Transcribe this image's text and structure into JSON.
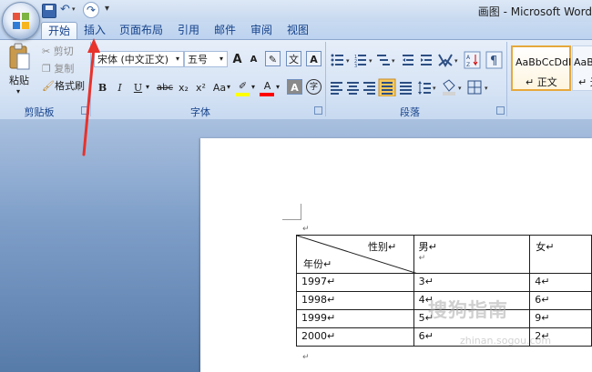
{
  "window": {
    "title": "画图 - Microsoft Word"
  },
  "quick_access": {
    "undo_glyph": "↶",
    "redo_glyph": "↷",
    "more_glyph": "▾"
  },
  "tabs": [
    "开始",
    "插入",
    "页面布局",
    "引用",
    "邮件",
    "审阅",
    "视图"
  ],
  "active_tab": "开始",
  "clipboard": {
    "paste": "粘贴",
    "cut": "剪切",
    "copy": "复制",
    "format_painter": "格式刷",
    "group_title": "剪贴板"
  },
  "font": {
    "font_name": "宋体 (中文正文)",
    "font_size": "五号",
    "group_title": "字体",
    "bold": "B",
    "italic": "I",
    "underline": "U",
    "strike": "abc",
    "subscript": "x₂",
    "superscript": "x²",
    "change_case": "Aa",
    "grow": "A",
    "shrink": "A",
    "clear": "A",
    "highlight_color": "#ffff00",
    "font_color": "#ff0000"
  },
  "paragraph": {
    "group_title": "段落"
  },
  "styles": {
    "sample1": "AaBbCcDdI",
    "name1": "↵ 正文",
    "sample2": "AaB",
    "name2": "↵ 无"
  },
  "table": {
    "header": {
      "diag_top": "性别↵",
      "diag_bottom": "年份↵",
      "male": "男↵",
      "male_end": "↵",
      "female": "女↵"
    },
    "rows": [
      {
        "year": "1997↵",
        "male": "3↵",
        "female": "4↵"
      },
      {
        "year": "1998↵",
        "male": "4↵",
        "female": "6↵"
      },
      {
        "year": "1999↵",
        "male": "5↵",
        "female": "9↵"
      },
      {
        "year": "2000↵",
        "male": "6↵",
        "female": "2↵"
      }
    ]
  },
  "paragraph_mark": "↵",
  "watermark": {
    "main": "搜狗指南",
    "sub": "zhinan.sogou.com"
  },
  "colors": {
    "accent": "#15428b",
    "arrow": "#e8322c"
  }
}
